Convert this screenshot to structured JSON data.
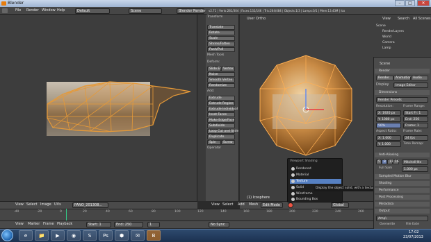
{
  "window": {
    "title": "Blender",
    "minimize": "–",
    "maximize": "□",
    "close": "✕"
  },
  "info_header": {
    "menus": [
      "File",
      "Render",
      "Window",
      "Help"
    ],
    "screen_layout": "Default",
    "scene": "Scene",
    "render_engine": "Blender Render",
    "stats": "v2.71 | Verts:281/304 | Faces:132/166 | Tris:264/484 | Objects:1/3 | Lamps:0/1 | Mem:13.43M | Ico"
  },
  "left_view": {
    "header_menus": [
      "View",
      "Select",
      "Image",
      "UVs"
    ],
    "image_name": "PANO_201308..."
  },
  "tool_shelf": {
    "section_transform": "Transform",
    "transform_buttons": [
      "Translate",
      "Rotate",
      "Scale",
      "Shrink/Fatten",
      "Push/Pull"
    ],
    "section_mesh_tools": "Mesh Tools",
    "deform_label": "Deform:",
    "deform_buttons": [
      "Slide Ed",
      "Vertex",
      "Noise",
      "Smooth Vertex",
      "Randomize"
    ],
    "add_label": "Add:",
    "add_buttons": [
      "Extrude",
      "Extrude Region",
      "Extrude Individual",
      "Inset Faces",
      "Make Edge/Face",
      "Subdivide",
      "Loop Cut and Slide",
      "Duplicate",
      "Spin",
      "Screw"
    ],
    "operator_label": "Operator"
  },
  "right_view": {
    "label": "User Ortho",
    "object_label": "(1) Icosphere",
    "header_menus": [
      "View",
      "Select",
      "Add",
      "Mesh"
    ],
    "mode": "Edit Mode",
    "pivot": "Global"
  },
  "viewport_shading_menu": {
    "title": "Viewport Shading",
    "items": [
      "Rendered",
      "Material",
      "Texture",
      "Solid",
      "Wireframe",
      "Bounding Box"
    ],
    "selected": "Texture",
    "tooltip": "Display the object solid, with a texture"
  },
  "outliner": {
    "header": [
      "View",
      "Search",
      "All Scenes"
    ],
    "rows": [
      "Scene",
      "RenderLayers",
      "World",
      "Camera",
      "Lamp"
    ]
  },
  "properties": {
    "context": "Scene",
    "render_section": "Render",
    "render_buttons": [
      "Render",
      "Animation",
      "Audio"
    ],
    "display": "Display",
    "display_value": "Image Editor",
    "dimensions": "Dimensions",
    "render_presets": "Render Presets",
    "resolution_label": "Resolution:",
    "res_x": "X: 1920 px",
    "res_y": "Y: 1080 px",
    "res_pct": "50%",
    "frame_range_label": "Frame Range:",
    "start_frame": "Start Fr: 1",
    "end_frame": "End: 250",
    "frame_step": "Frame: 1",
    "aspect_label": "Aspect Ratio:",
    "aspect_x": "X: 1.000",
    "aspect_y": "Y: 1.000",
    "frame_rate_label": "Frame Rate:",
    "frame_rate": "24 fps",
    "time_remap": "Time Remap:",
    "anti_aliasing": "Anti-Aliasing",
    "aa_values": [
      "5",
      "8",
      "11",
      "16"
    ],
    "aa_filter": "Mitchell-Ne",
    "full_sample": "Full Sam",
    "size": "1.000 px",
    "sections": [
      "Sampled Motion Blur",
      "Shading",
      "Performance",
      "Post Processing",
      "Metadata",
      "Output"
    ],
    "output_path": "/tmp\\",
    "output_opts": [
      "Overwrite",
      "File Exte"
    ]
  },
  "timeline": {
    "header_menus": [
      "View",
      "Marker",
      "Frame",
      "Playback"
    ],
    "start": "Start:",
    "start_val": "1",
    "end": "End:",
    "end_val": "250",
    "current": "1",
    "sync": "No Sync",
    "ticks": [
      "-40",
      "-20",
      "0",
      "20",
      "40",
      "60",
      "80",
      "100",
      "120",
      "140",
      "160",
      "180",
      "200",
      "220",
      "240",
      "260"
    ]
  },
  "taskbar": {
    "apps": [
      "e",
      "📁",
      "▶",
      "◉",
      "S",
      "Ps",
      "⬢",
      "✉",
      "B"
    ],
    "time": "17:02",
    "date": "23/07/2013"
  }
}
